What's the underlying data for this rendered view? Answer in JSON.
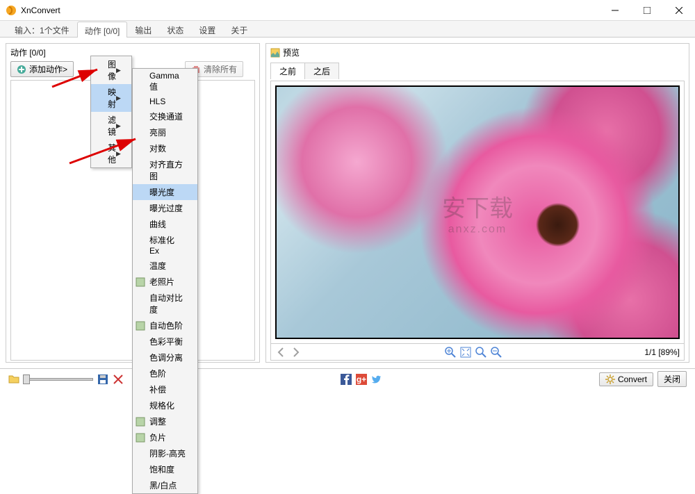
{
  "window": {
    "title": "XnConvert"
  },
  "tabs": [
    {
      "label": "输入：1个文件",
      "active": false
    },
    {
      "label": "动作 [0/0]",
      "active": true
    },
    {
      "label": "输出",
      "active": false
    },
    {
      "label": "状态",
      "active": false
    },
    {
      "label": "设置",
      "active": false
    },
    {
      "label": "关于",
      "active": false
    }
  ],
  "left_panel": {
    "title": "动作 [0/0]",
    "add_btn": "添加动作>",
    "clear_btn": "清除所有"
  },
  "menu1": {
    "items": [
      {
        "label": "图像",
        "arrow": true
      },
      {
        "label": "映射",
        "arrow": true,
        "highlighted": true
      },
      {
        "label": "滤镜",
        "arrow": true
      },
      {
        "label": "其他",
        "arrow": true
      }
    ]
  },
  "menu2": {
    "items": [
      {
        "label": "Gamma值"
      },
      {
        "label": "HLS"
      },
      {
        "label": "交换通道"
      },
      {
        "label": "亮丽"
      },
      {
        "label": "对数"
      },
      {
        "label": "对齐直方图"
      },
      {
        "label": "曝光度",
        "highlighted": true
      },
      {
        "label": "曝光过度"
      },
      {
        "label": "曲线"
      },
      {
        "label": "标准化 Ex"
      },
      {
        "label": "温度"
      },
      {
        "label": "老照片",
        "icon": true
      },
      {
        "label": "自动对比度"
      },
      {
        "label": "自动色阶",
        "icon": true
      },
      {
        "label": "色彩平衡"
      },
      {
        "label": "色调分离"
      },
      {
        "label": "色阶"
      },
      {
        "label": "补偿"
      },
      {
        "label": "规格化"
      },
      {
        "label": "调整",
        "icon": true
      },
      {
        "label": "负片",
        "icon": true
      },
      {
        "label": "阴影-高亮"
      },
      {
        "label": "饱和度"
      },
      {
        "label": "黑/白点"
      }
    ]
  },
  "right_panel": {
    "title": "预览",
    "tabs": {
      "before": "之前",
      "after": "之后"
    },
    "nav_counter": "1/1 [89%]"
  },
  "watermark": {
    "line1": "安下载",
    "line2": "anxz.com"
  },
  "bottom": {
    "convert": "Convert",
    "close": "关闭"
  }
}
